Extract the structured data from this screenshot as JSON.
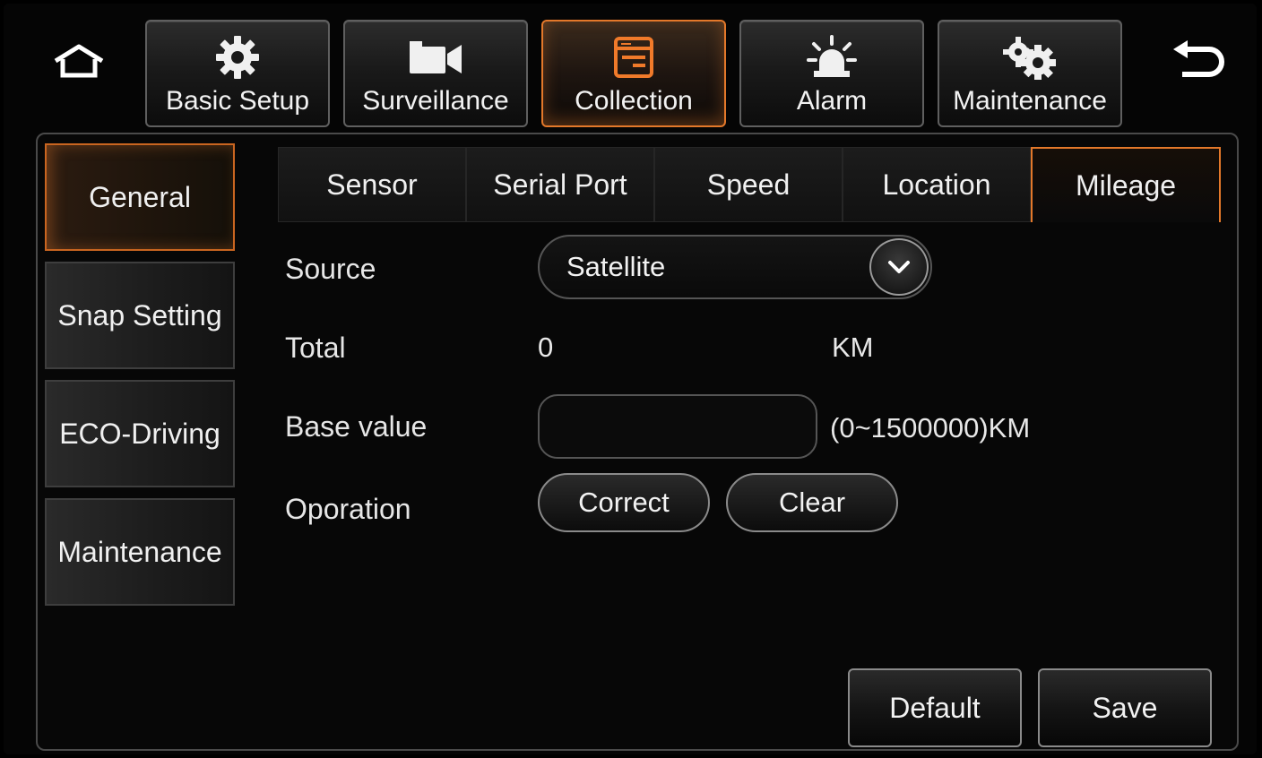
{
  "top_nav": {
    "tabs": [
      {
        "label": "Basic Setup",
        "icon": "gear-icon"
      },
      {
        "label": "Surveillance",
        "icon": "camera-icon"
      },
      {
        "label": "Collection",
        "icon": "document-icon",
        "active": true
      },
      {
        "label": "Alarm",
        "icon": "alarm-light-icon"
      },
      {
        "label": "Maintenance",
        "icon": "gears-icon"
      }
    ],
    "home_icon": "home-icon",
    "back_icon": "back-arrow-icon"
  },
  "sidebar": {
    "items": [
      {
        "label": "General",
        "active": true
      },
      {
        "label": "Snap Setting"
      },
      {
        "label": "ECO-Driving"
      },
      {
        "label": "Maintenance"
      }
    ]
  },
  "sub_tabs": [
    {
      "label": "Sensor"
    },
    {
      "label": "Serial Port"
    },
    {
      "label": "Speed"
    },
    {
      "label": "Location"
    },
    {
      "label": "Mileage",
      "active": true
    }
  ],
  "form": {
    "source": {
      "label": "Source",
      "value": "Satellite"
    },
    "total": {
      "label": "Total",
      "value": "0",
      "unit": "KM"
    },
    "base_value": {
      "label": "Base value",
      "value": "",
      "range": "(0~1500000)KM"
    },
    "operation": {
      "label": "Oporation",
      "correct": "Correct",
      "clear": "Clear"
    }
  },
  "footer": {
    "default_label": "Default",
    "save_label": "Save"
  },
  "colors": {
    "accent": "#e3782a",
    "background": "#050505",
    "border": "#4a4a4a"
  }
}
